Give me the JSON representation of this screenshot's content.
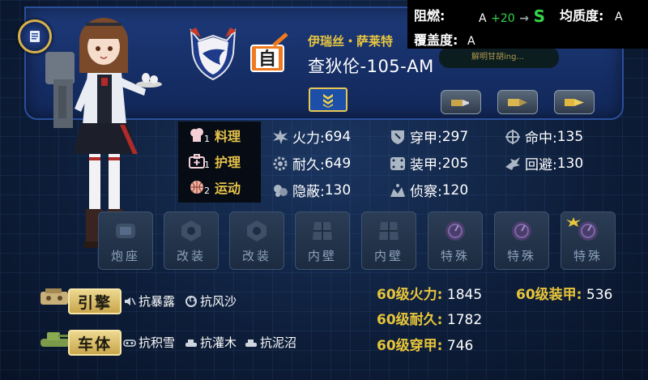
{
  "props": {
    "flame_label": "阻燃:",
    "flame_from": "A",
    "flame_delta": "+20",
    "flame_to": "S",
    "uniform_label": "均质度:",
    "uniform_value": "A",
    "cover_label": "覆盖度:",
    "cover_value": "A"
  },
  "tank": {
    "commander": "伊瑞丝・萨莱特",
    "name": "查狄伦-105-AM",
    "recognizing": "解明甘胡ing..."
  },
  "skills": [
    {
      "level": "1",
      "name": "料理",
      "icon": "chef-icon"
    },
    {
      "level": "1",
      "name": "护理",
      "icon": "medkit-icon"
    },
    {
      "level": "2",
      "name": "运动",
      "icon": "ball-icon"
    }
  ],
  "stats": {
    "firepower": {
      "label": "火力:",
      "value": "694"
    },
    "penetration": {
      "label": "穿甲:",
      "value": "297"
    },
    "accuracy": {
      "label": "命中:",
      "value": "135"
    },
    "durability": {
      "label": "耐久:",
      "value": "649"
    },
    "armor": {
      "label": "装甲:",
      "value": "205"
    },
    "evasion": {
      "label": "回避:",
      "value": "130"
    },
    "stealth": {
      "label": "隐蔽:",
      "value": "130"
    },
    "scouting": {
      "label": "侦察:",
      "value": "120"
    }
  },
  "slots": [
    {
      "label": "炮座",
      "icon": "turret-mount-icon"
    },
    {
      "label": "改装",
      "icon": "hex-nut-icon"
    },
    {
      "label": "改装",
      "icon": "hex-nut-icon"
    },
    {
      "label": "内壁",
      "icon": "wall-panel-icon"
    },
    {
      "label": "内壁",
      "icon": "wall-panel-icon"
    },
    {
      "label": "特殊",
      "icon": "gauge-icon"
    },
    {
      "label": "特殊",
      "icon": "gauge-icon"
    },
    {
      "label": "特殊",
      "icon": "gauge-icon"
    }
  ],
  "parts": {
    "engine": {
      "label": "引擎",
      "traits": [
        "抗暴露",
        "抗风沙"
      ]
    },
    "body": {
      "label": "车体",
      "traits": [
        "抗积雪",
        "抗灌木",
        "抗泥沼"
      ]
    }
  },
  "level60": {
    "firepower": {
      "label": "60级火力:",
      "value": "1845"
    },
    "armor": {
      "label": "60级装甲:",
      "value": "536"
    },
    "durability": {
      "label": "60级耐久:",
      "value": "1782"
    },
    "penetration": {
      "label": "60级穿甲:",
      "value": "746"
    }
  },
  "colors": {
    "accent_gold": "#e8c53a",
    "upgrade_green": "#35d64a",
    "panel_blue": "#152c62"
  }
}
